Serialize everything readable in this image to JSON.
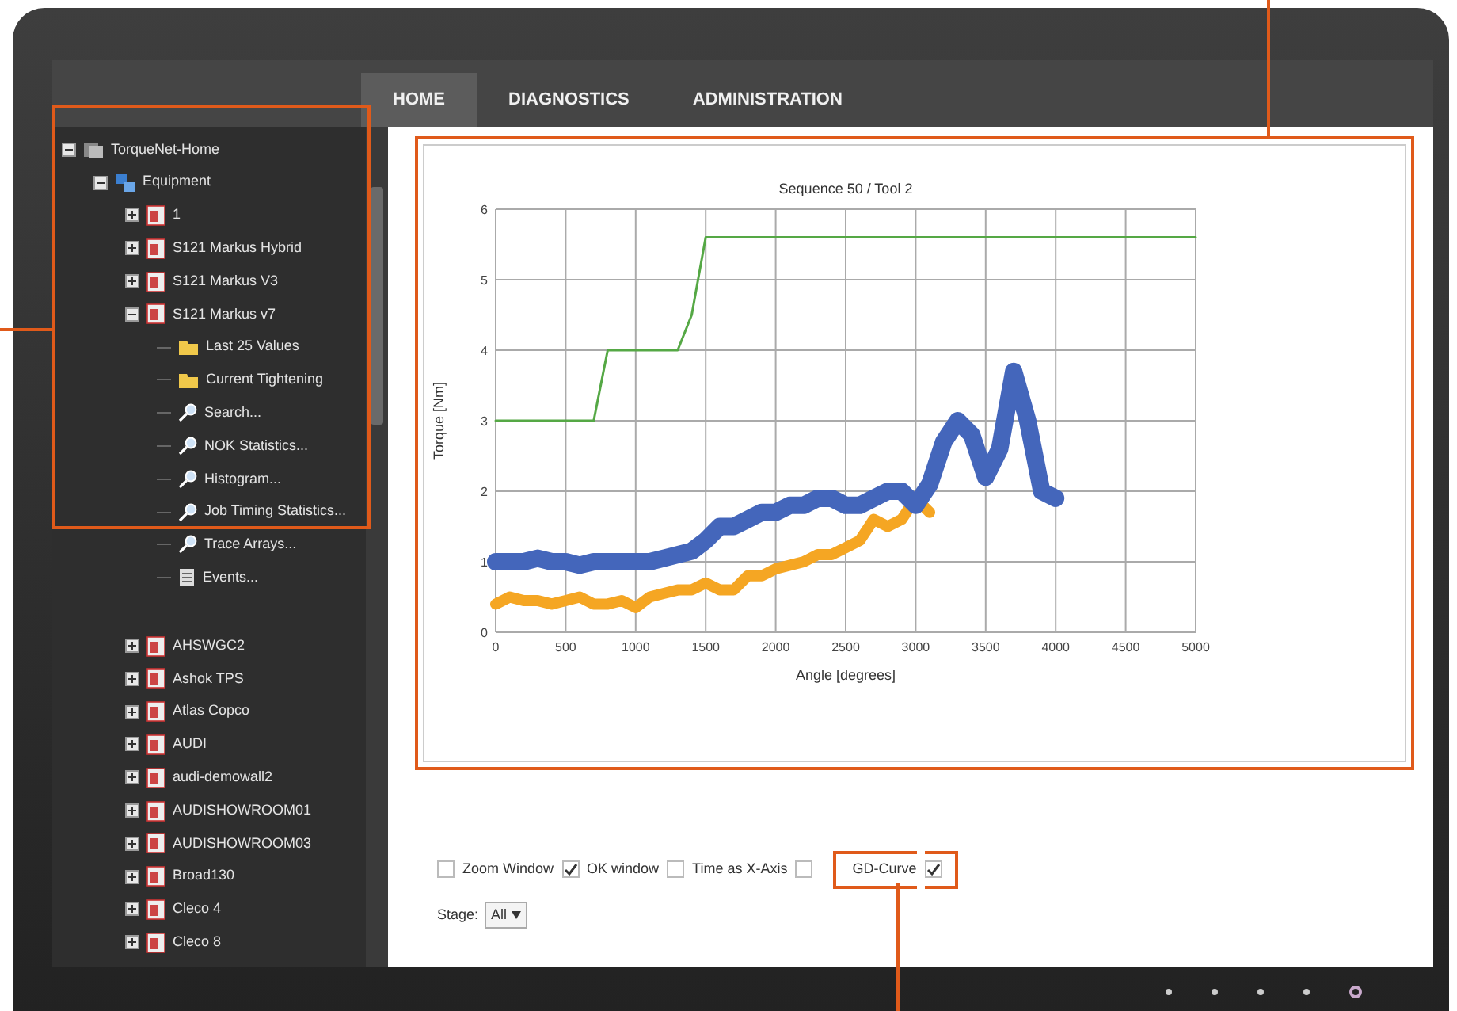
{
  "tabs": [
    {
      "label": "HOME",
      "selected": true
    },
    {
      "label": "DIAGNOSTICS",
      "selected": false
    },
    {
      "label": "ADMINISTRATION",
      "selected": false
    }
  ],
  "tree": [
    {
      "label": "TorqueNet-Home",
      "kind": "home",
      "expanded": true,
      "children": [
        {
          "label": "Equipment",
          "kind": "equipment",
          "expanded": true,
          "children": [
            {
              "label": "1",
              "kind": "device",
              "expanded": false
            },
            {
              "label": "S121 Markus Hybrid",
              "kind": "device",
              "expanded": false
            },
            {
              "label": "S121 Markus V3",
              "kind": "device",
              "expanded": false
            },
            {
              "label": "S121 Markus v7",
              "kind": "device",
              "expanded": true,
              "children": [
                {
                  "label": "Last 25 Values",
                  "kind": "folder"
                },
                {
                  "label": "Current Tightening",
                  "kind": "folder"
                },
                {
                  "label": "Search...",
                  "kind": "tool"
                },
                {
                  "label": "NOK Statistics...",
                  "kind": "tool"
                },
                {
                  "label": "Histogram...",
                  "kind": "tool"
                },
                {
                  "label": "Job Timing Statistics...",
                  "kind": "tool"
                },
                {
                  "label": "Trace Arrays...",
                  "kind": "tool"
                },
                {
                  "label": "Events...",
                  "kind": "report"
                }
              ]
            },
            {
              "label": "AHSWGC2",
              "kind": "device",
              "expanded": false
            },
            {
              "label": "Ashok TPS",
              "kind": "device",
              "expanded": false
            },
            {
              "label": "Atlas Copco",
              "kind": "device",
              "expanded": false
            },
            {
              "label": "AUDI",
              "kind": "device",
              "expanded": false
            },
            {
              "label": "audi-demowall2",
              "kind": "device",
              "expanded": false
            },
            {
              "label": "AUDISHOWROOM01",
              "kind": "device",
              "expanded": false
            },
            {
              "label": "AUDISHOWROOM03",
              "kind": "device",
              "expanded": false
            },
            {
              "label": "Broad130",
              "kind": "device",
              "expanded": false
            },
            {
              "label": "Cleco 4",
              "kind": "device",
              "expanded": false
            },
            {
              "label": "Cleco 8",
              "kind": "device",
              "expanded": false
            }
          ]
        }
      ]
    }
  ],
  "chart": {
    "chart_data": {
      "type": "line",
      "title": "Sequence 50 / Tool 2",
      "xlabel": "Angle [degrees]",
      "ylabel": "Torque [Nm]",
      "x": [
        0,
        100,
        200,
        300,
        400,
        500,
        600,
        700,
        800,
        900,
        1000,
        1100,
        1200,
        1300,
        1400,
        1500,
        1600,
        1700,
        1800,
        1900,
        2000,
        2100,
        2200,
        2300,
        2400,
        2500,
        2600,
        2700,
        2800,
        2900,
        3000,
        3100,
        3200,
        3300,
        3400,
        3500,
        3600,
        3700,
        3800,
        3900,
        4000,
        4100,
        4200,
        4300,
        4400,
        4500,
        4600,
        4700,
        4800,
        4900,
        5000
      ],
      "series": [
        {
          "color": "#55a845",
          "values": [
            3,
            3,
            3,
            3,
            3,
            3,
            3,
            3,
            4,
            4,
            4,
            4,
            4,
            4,
            4.5,
            5.6,
            5.6,
            5.6,
            5.6,
            5.6,
            5.6,
            5.6,
            5.6,
            5.6,
            5.6,
            5.6,
            5.6,
            5.6,
            5.6,
            5.6,
            5.6,
            5.6,
            5.6,
            5.6,
            5.6,
            5.6,
            5.6,
            5.6,
            5.6,
            5.6,
            5.6,
            5.6,
            5.6,
            5.6,
            5.6,
            5.6,
            5.6,
            5.6,
            5.6,
            5.6,
            5.6
          ]
        },
        {
          "color": "#f5a623",
          "values": [
            0.4,
            0.5,
            0.45,
            0.45,
            0.4,
            0.45,
            0.5,
            0.4,
            0.4,
            0.45,
            0.35,
            0.5,
            0.55,
            0.6,
            0.6,
            0.7,
            0.6,
            0.6,
            0.8,
            0.8,
            0.9,
            0.95,
            1.0,
            1.1,
            1.1,
            1.2,
            1.3,
            1.6,
            1.5,
            1.6,
            1.9,
            1.7,
            null,
            null,
            null,
            null,
            null,
            null,
            null,
            null,
            null,
            null,
            null,
            null,
            null,
            null,
            null,
            null,
            null,
            null,
            null
          ]
        },
        {
          "color": "#4466bb",
          "values": [
            1.0,
            1.0,
            1.0,
            1.05,
            1.0,
            1.0,
            0.95,
            1.0,
            1.0,
            1.0,
            1.0,
            1.0,
            1.05,
            1.1,
            1.15,
            1.3,
            1.5,
            1.5,
            1.6,
            1.7,
            1.7,
            1.8,
            1.8,
            1.9,
            1.9,
            1.8,
            1.8,
            1.9,
            2.0,
            2.0,
            1.8,
            2.1,
            2.7,
            3.0,
            2.8,
            2.2,
            2.6,
            3.7,
            3.0,
            2.0,
            1.9,
            null,
            null,
            null,
            null,
            null,
            null,
            null,
            null,
            null,
            null
          ]
        }
      ],
      "xlim": [
        0,
        5000
      ],
      "ylim": [
        0,
        6
      ],
      "grid": true,
      "xticks": [
        0,
        500,
        1000,
        1500,
        2000,
        2500,
        3000,
        3500,
        4000,
        4500,
        5000
      ],
      "yticks": [
        0,
        1,
        2,
        3,
        4,
        5,
        6
      ]
    }
  },
  "options": [
    {
      "kind": "checkbox",
      "checked": false,
      "highlighted": false
    },
    {
      "kind": "label",
      "label": "Zoom Window",
      "highlighted": false
    },
    {
      "kind": "checkbox",
      "checked": true,
      "highlighted": false
    },
    {
      "kind": "label",
      "label": "OK window",
      "highlighted": false
    },
    {
      "kind": "checkbox",
      "checked": false,
      "highlighted": false
    },
    {
      "kind": "label",
      "label": "Time as X-Axis",
      "highlighted": false
    },
    {
      "kind": "checkbox",
      "checked": false,
      "highlighted": false
    },
    {
      "kind": "label",
      "label": "GD-Curve",
      "highlighted": true
    },
    {
      "kind": "checkbox",
      "checked": true,
      "highlighted": true
    }
  ],
  "stage": {
    "label": "Stage:",
    "value": "All"
  }
}
